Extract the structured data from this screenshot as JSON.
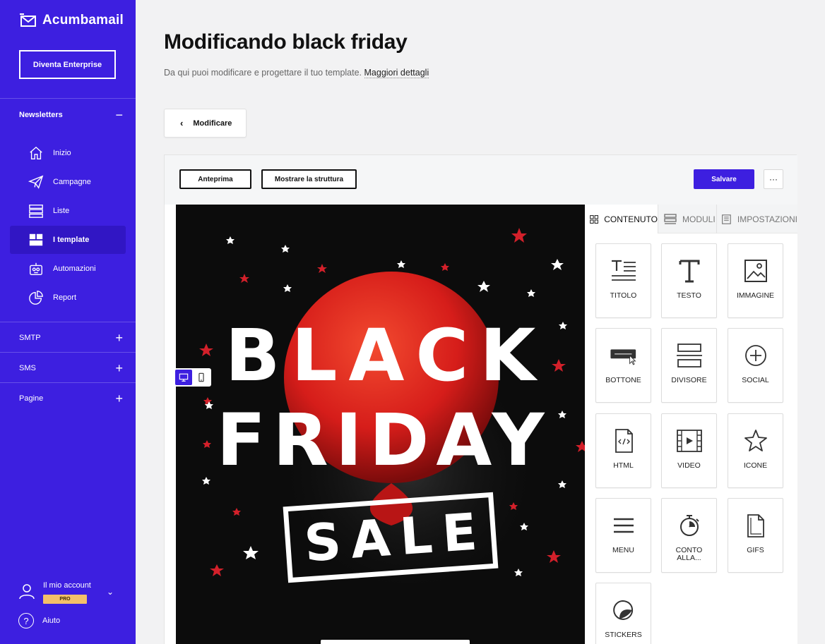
{
  "brand": {
    "name": "Acumbamail"
  },
  "sidebar": {
    "enterprise_label": "Diventa Enterprise",
    "sections": {
      "newsletters": "Newsletters",
      "smtp": "SMTP",
      "sms": "SMS",
      "pagine": "Pagine"
    },
    "items": [
      {
        "label": "Inizio",
        "icon": "home-icon"
      },
      {
        "label": "Campagne",
        "icon": "paper-plane-icon"
      },
      {
        "label": "Liste",
        "icon": "list-icon"
      },
      {
        "label": "I template",
        "icon": "template-icon",
        "active": true
      },
      {
        "label": "Automazioni",
        "icon": "robot-icon"
      },
      {
        "label": "Report",
        "icon": "pie-chart-icon"
      }
    ],
    "account_label": "Il mio account",
    "account_badge": "PRO",
    "help_label": "Aiuto"
  },
  "header": {
    "title": "Modificando black friday",
    "subtitle": "Da qui puoi modificare e progettare il tuo template.",
    "more_link": "Maggiori dettagli",
    "back_label": "Modificare"
  },
  "toolbar": {
    "preview_label": "Anteprima",
    "structure_label": "Mostrare la struttura",
    "save_label": "Salvare",
    "more_label": "···"
  },
  "canvas": {
    "line1": "BLACK",
    "line2": "FRIDAY",
    "line3": "SALE",
    "colors": {
      "background": "#0c0c0c",
      "balloon": "#e3231e",
      "star_red": "#d3202a"
    }
  },
  "panel": {
    "tabs": [
      {
        "label": "CONTENUTO",
        "icon": "grid-icon"
      },
      {
        "label": "MODULI",
        "icon": "modules-icon"
      },
      {
        "label": "IMPOSTAZIONI",
        "icon": "settings-doc-icon"
      }
    ],
    "blocks": [
      {
        "label": "TITOLO",
        "icon": "title-icon"
      },
      {
        "label": "TESTO",
        "icon": "text-icon"
      },
      {
        "label": "IMMAGINE",
        "icon": "image-icon"
      },
      {
        "label": "BOTTONE",
        "icon": "button-icon"
      },
      {
        "label": "DIVISORE",
        "icon": "divider-icon"
      },
      {
        "label": "SOCIAL",
        "icon": "plus-circle-icon"
      },
      {
        "label": "HTML",
        "icon": "html-file-icon"
      },
      {
        "label": "VIDEO",
        "icon": "video-icon"
      },
      {
        "label": "ICONE",
        "icon": "star-icon"
      },
      {
        "label": "MENU",
        "icon": "menu-icon"
      },
      {
        "label": "CONTO ALLA...",
        "icon": "timer-icon"
      },
      {
        "label": "GIFS",
        "icon": "gif-file-icon"
      },
      {
        "label": "STICKERS",
        "icon": "sticker-icon"
      }
    ]
  },
  "colors": {
    "primary": "#3d1fe0",
    "sidebar_active": "#3116c4",
    "badge": "#f4c06a"
  }
}
